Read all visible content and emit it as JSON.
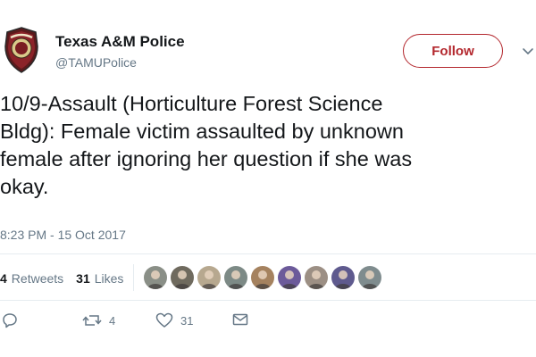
{
  "account": {
    "name": "Texas A&M Police",
    "handle": "@TAMUPolice",
    "logo_text": "UNIVERSITY POLICE"
  },
  "follow_button": {
    "label": "Follow"
  },
  "tweet": {
    "text": "10/9-Assault (Horticulture Forest Science\nBldg): Female victim assaulted by unknown\nfemale after ignoring her question if she was\nokay.",
    "timestamp": "8:23 PM - 15 Oct 2017"
  },
  "stats": {
    "retweets_count": "4",
    "retweets_label": "Retweets",
    "likes_count": "31",
    "likes_label": "Likes"
  },
  "likers": [
    {
      "name": "liker-1",
      "color": "#8a8f87"
    },
    {
      "name": "liker-2",
      "color": "#6f6a5e"
    },
    {
      "name": "liker-3",
      "color": "#b7a88f"
    },
    {
      "name": "liker-4",
      "color": "#7d8a86"
    },
    {
      "name": "liker-5",
      "color": "#a5825f"
    },
    {
      "name": "liker-6",
      "color": "#6c5a9a"
    },
    {
      "name": "liker-7",
      "color": "#9c8f84"
    },
    {
      "name": "liker-8",
      "color": "#5f5a8e"
    },
    {
      "name": "liker-9",
      "color": "#7f8c8e"
    }
  ],
  "actions": {
    "reply_count": "",
    "retweet_count": "4",
    "like_count": "31"
  },
  "colors": {
    "brand": "#b3272d",
    "muted": "#657786",
    "text": "#14171a",
    "divider": "#e6ecf0"
  },
  "icons": [
    "police-badge-logo",
    "chevron-down-icon",
    "reply-icon",
    "retweet-icon",
    "heart-icon",
    "envelope-icon"
  ]
}
